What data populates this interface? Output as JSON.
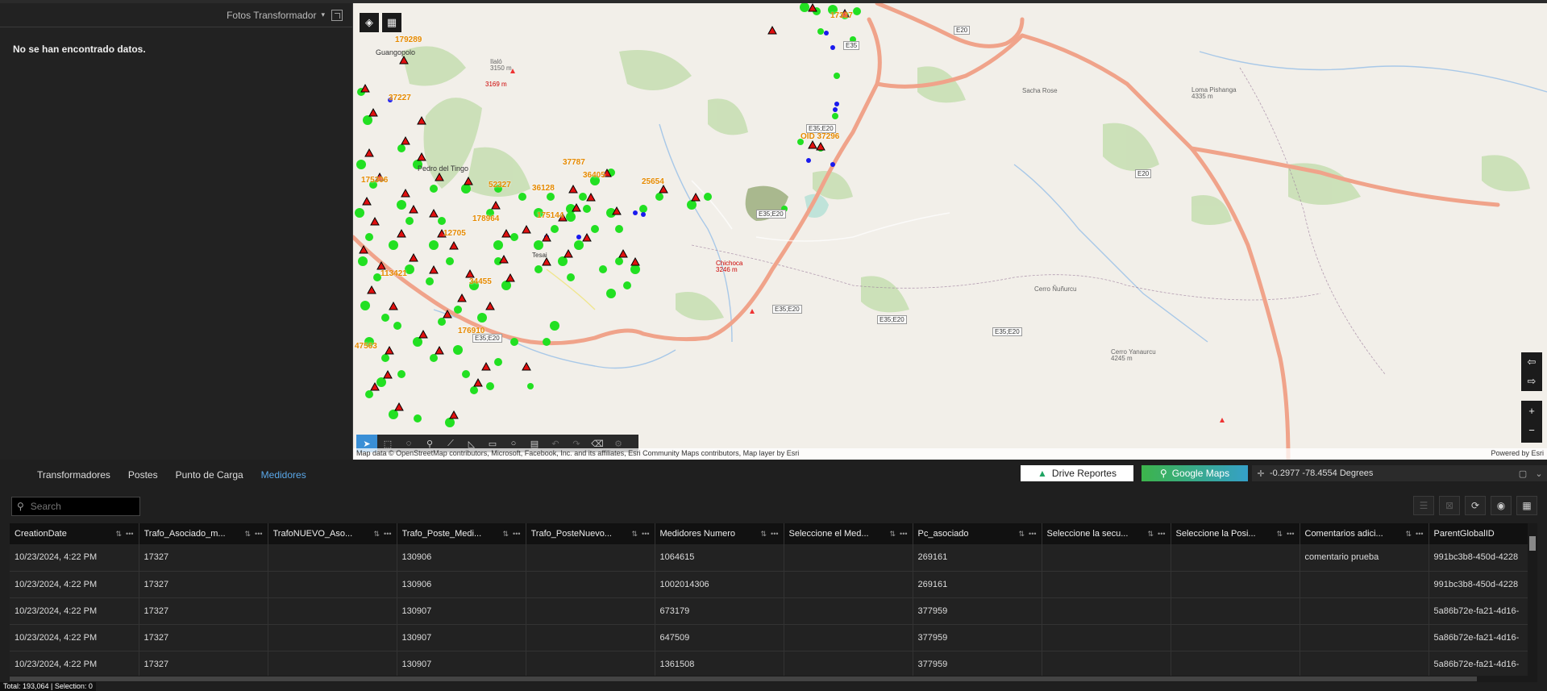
{
  "left_panel": {
    "selector_label": "Fotos Transformador",
    "empty_message": "No se han encontrado datos."
  },
  "map": {
    "attribution": "Map data © OpenStreetMap contributors, Microsoft, Facebook, Inc. and its affiliates, Esri Community Maps contributors, Map layer by Esri",
    "powered_by": "Powered by Esri",
    "place_labels": [
      {
        "text": "Guangopolo"
      },
      {
        "text": "Sacha Rose"
      },
      {
        "text": "Loma Pishanga"
      },
      {
        "text": "4335 m"
      },
      {
        "text": "Chichoca"
      },
      {
        "text": "3246 m"
      },
      {
        "text": "Cerro Ñuñurcu"
      },
      {
        "text": "Cerro Yanaurcu"
      },
      {
        "text": "4245 m"
      },
      {
        "text": "Ilaló"
      },
      {
        "text": "3150 m"
      },
      {
        "text": "3169 m"
      },
      {
        "text": "Pedro del Tingo"
      },
      {
        "text": "Tesai"
      }
    ],
    "road_labels": [
      "E20",
      "E35",
      "E35;E20",
      "E35;E20",
      "E35;E20",
      "E35;E20",
      "E35;E20",
      "E35;E20",
      "E20"
    ],
    "feature_labels": [
      "179289",
      "37227",
      "175306",
      "37787",
      "36405",
      "52327",
      "36128",
      "25654",
      "175144",
      "178964",
      "12705",
      "113421",
      "34455",
      "176910",
      "47563",
      "OID 37296",
      "17327"
    ],
    "colors": {
      "background": "#f2efe9",
      "road": "#f0a38a",
      "park": "#b8d6a2",
      "green_marker": "#22e022",
      "blue_marker": "#1a1aee",
      "label": "#e68a00"
    }
  },
  "bottom": {
    "tabs": [
      {
        "label": "Transformadores",
        "active": false
      },
      {
        "label": "Postes",
        "active": false
      },
      {
        "label": "Punto de Carga",
        "active": false
      },
      {
        "label": "Medidores",
        "active": true
      }
    ],
    "drive_button": "Drive Reportes",
    "gmaps_button": "Google Maps",
    "coordinates": "-0.2977 -78.4554 Degrees",
    "search_placeholder": "Search",
    "columns": [
      "CreationDate",
      "Trafo_Asociado_m...",
      "TrafoNUEVO_Aso...",
      "Trafo_Poste_Medi...",
      "Trafo_PosteNuevo...",
      "Medidores Numero",
      "Seleccione el Med...",
      "Pc_asociado",
      "Seleccione la secu...",
      "Seleccione la Posi...",
      "Comentarios adici...",
      "ParentGlobalID"
    ],
    "rows": [
      [
        "10/23/2024, 4:22 PM",
        "17327",
        "",
        "130906",
        "",
        "1064615",
        "",
        "269161",
        "",
        "",
        "comentario prueba",
        "991bc3b8-450d-4228"
      ],
      [
        "10/23/2024, 4:22 PM",
        "17327",
        "",
        "130906",
        "",
        "1002014306",
        "",
        "269161",
        "",
        "",
        "",
        "991bc3b8-450d-4228"
      ],
      [
        "10/23/2024, 4:22 PM",
        "17327",
        "",
        "130907",
        "",
        "673179",
        "",
        "377959",
        "",
        "",
        "",
        "5a86b72e-fa21-4d16-"
      ],
      [
        "10/23/2024, 4:22 PM",
        "17327",
        "",
        "130907",
        "",
        "647509",
        "",
        "377959",
        "",
        "",
        "",
        "5a86b72e-fa21-4d16-"
      ],
      [
        "10/23/2024, 4:22 PM",
        "17327",
        "",
        "130907",
        "",
        "1361508",
        "",
        "377959",
        "",
        "",
        "",
        "5a86b72e-fa21-4d16-"
      ]
    ],
    "status": "Total: 193,064 | Selection: 0"
  }
}
